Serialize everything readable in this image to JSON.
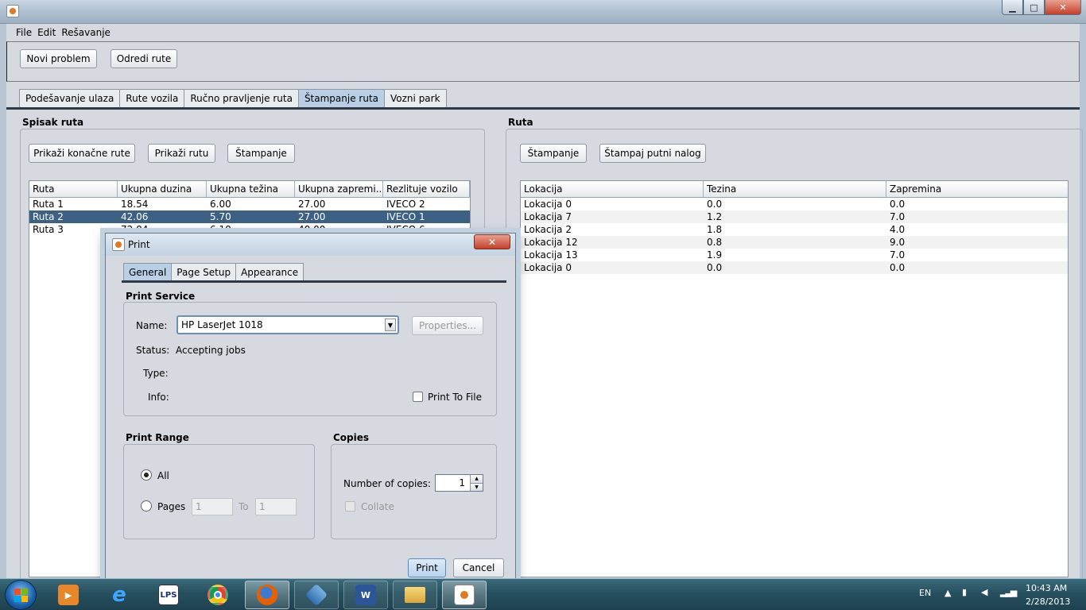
{
  "window": {
    "minimize": "▁",
    "maximize": "□",
    "close": "✕"
  },
  "menu": [
    "File",
    "Edit",
    "Rešavanje"
  ],
  "toolbar": {
    "novi_problem": "Novi problem",
    "odredi_rute": "Odredi rute"
  },
  "tabs": [
    "Podešavanje ulaza",
    "Rute vozila",
    "Ručno pravljenje ruta",
    "Štampanje ruta",
    "Vozni park"
  ],
  "active_tab": "Štampanje ruta",
  "left_panel": {
    "title": "Spisak ruta",
    "buttons": {
      "prikazi_konacne": "Prikaži konačne rute",
      "prikazi_rutu": "Prikaži rutu",
      "stampanje": "Štampanje"
    },
    "columns": [
      "Ruta",
      "Ukupna duzina",
      "Ukupna težina",
      "Ukupna zapremi...",
      "Rezlituje vozilo"
    ],
    "rows": [
      [
        "Ruta 1",
        "18.54",
        "6.00",
        "27.00",
        "IVECO 2"
      ],
      [
        "Ruta 2",
        "42.06",
        "5.70",
        "27.00",
        "IVECO 1"
      ],
      [
        "Ruta 3",
        "72.04",
        "6.10",
        "40.00",
        "IVECO 6"
      ]
    ],
    "selected_row": "Ruta 2"
  },
  "right_panel": {
    "title": "Ruta",
    "buttons": {
      "stampanje": "Štampanje",
      "stampaj_putni_nalog": "Štampaj putni nalog"
    },
    "columns": [
      "Lokacija",
      "Tezina",
      "Zapremina"
    ],
    "rows": [
      [
        "Lokacija 0",
        "0.0",
        "0.0"
      ],
      [
        "Lokacija 7",
        "1.2",
        "7.0"
      ],
      [
        "Lokacija 2",
        "1.8",
        "4.0"
      ],
      [
        "Lokacija 12",
        "0.8",
        "9.0"
      ],
      [
        "Lokacija 13",
        "1.9",
        "7.0"
      ],
      [
        "Lokacija 0",
        "0.0",
        "0.0"
      ]
    ]
  },
  "print_dialog": {
    "title": "Print",
    "close": "✕",
    "tabs": [
      "General",
      "Page Setup",
      "Appearance"
    ],
    "active_tab": "General",
    "print_service": {
      "title": "Print Service",
      "name_label": "Name:",
      "name_value": "HP LaserJet 1018",
      "properties": "Properties...",
      "status_label": "Status:",
      "status_value": "Accepting jobs",
      "type_label": "Type:",
      "info_label": "Info:",
      "print_to_file": "Print To File",
      "print_to_file_checked": false
    },
    "print_range": {
      "title": "Print Range",
      "all": "All",
      "pages": "Pages",
      "from": "1",
      "to_label": "To",
      "to": "1",
      "selected": "All"
    },
    "copies": {
      "title": "Copies",
      "number_label": "Number of copies:",
      "number": "1",
      "collate": "Collate"
    },
    "buttons": {
      "print": "Print",
      "cancel": "Cancel"
    }
  },
  "taskbar": {
    "items": [
      "media-player",
      "internet-explorer",
      "LPS",
      "chrome",
      "firefox",
      "virtualbox",
      "word",
      "explorer",
      "java"
    ],
    "lps_label": "LPS",
    "word_label": "W",
    "language": "EN",
    "time": "10:43 AM",
    "date": "2/28/2013"
  },
  "colors": {
    "selection": "#3d6185",
    "active_tab": "#b8cfe6",
    "taskbar": "#27505f"
  }
}
